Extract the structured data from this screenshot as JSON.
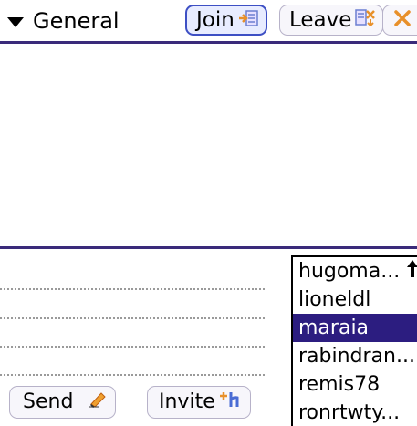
{
  "header": {
    "channel": "General",
    "join_label": "Join",
    "leave_label": "Leave"
  },
  "compose": {
    "send_label": "Send",
    "invite_label": "Invite"
  },
  "users": [
    {
      "name": "hugoma..."
    },
    {
      "name": "lioneldl"
    },
    {
      "name": "maraia",
      "selected": true
    },
    {
      "name": "rabindran..."
    },
    {
      "name": "remis78"
    },
    {
      "name": "ronrtwty..."
    }
  ],
  "colors": {
    "accent": "#2c1d80",
    "rule": "#3a2a7a",
    "join_border": "#3d4fc4"
  },
  "icons": {
    "channel_dropdown": "triangle-down-icon",
    "join": "join-icon",
    "leave": "leave-icon",
    "close": "close-icon",
    "send": "pencil-icon",
    "invite": "add-user-icon",
    "scroll": "scroll-up-arrow-icon"
  }
}
